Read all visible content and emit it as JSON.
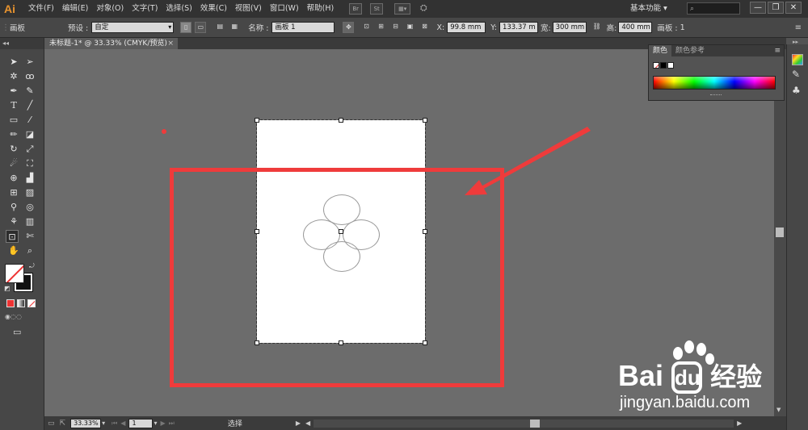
{
  "app": {
    "logo": "Ai"
  },
  "menu": [
    "文件(F)",
    "编辑(E)",
    "对象(O)",
    "文字(T)",
    "选择(S)",
    "效果(C)",
    "视图(V)",
    "窗口(W)",
    "帮助(H)"
  ],
  "menubar_buttons": [
    "Br",
    "St"
  ],
  "workspace_label": "基本功能",
  "window_buttons": [
    "—",
    "❐",
    "✕"
  ],
  "control_bar": {
    "tool_name": "画板",
    "preset_label": "预设 :",
    "preset_value": "自定",
    "name_label": "名称 :",
    "name_value": "画板 1",
    "x_label": "X:",
    "x_value": "99.8 mm",
    "y_label": "Y:",
    "y_value": "133.37 m",
    "width_label": "宽:",
    "width_value": "300 mm",
    "height_label": "高:",
    "height_value": "400 mm",
    "artboard_label": "画板 :",
    "artboard_value": "1"
  },
  "document_tab": {
    "title": "未标题-1* @ 33.33% (CMYK/预览)",
    "close": "×"
  },
  "color_panel": {
    "tabs": [
      "颜色",
      "颜色参考"
    ]
  },
  "status": {
    "zoom": "33.33%",
    "page": "1",
    "tool": "选择"
  },
  "watermark": {
    "brand": "Bai",
    "brand_cn": "经验",
    "url": "jingyan.baidu.com"
  },
  "colors": {
    "accent": "#ef3b3b",
    "logo": "#e8932e",
    "canvas": "#6c6c6c"
  }
}
